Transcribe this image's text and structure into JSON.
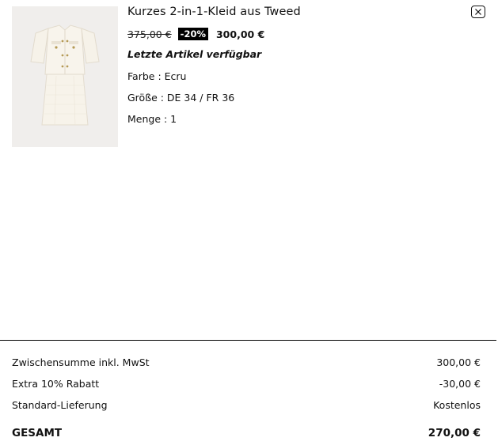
{
  "product": {
    "title": "Kurzes 2-in-1-Kleid aus Tweed",
    "old_price": "375,00 €",
    "discount": "-20%",
    "new_price": "300,00 €",
    "stock_notice": "Letzte Artikel verfügbar",
    "color": "Farbe : Ecru",
    "size": "Größe : DE 34 / FR 36",
    "quantity": "Menge : 1",
    "image_icon": "tweed-dress-image"
  },
  "close_icon": "close-icon",
  "summary": {
    "rows": [
      {
        "label": "Zwischensumme inkl. MwSt",
        "value": "300,00 €"
      },
      {
        "label": "Extra 10% Rabatt",
        "value": "-30,00 €"
      },
      {
        "label": "Standard-Lieferung",
        "value": "Kostenlos"
      }
    ],
    "total_label": "GESAMT",
    "total_value": "270,00 €"
  }
}
